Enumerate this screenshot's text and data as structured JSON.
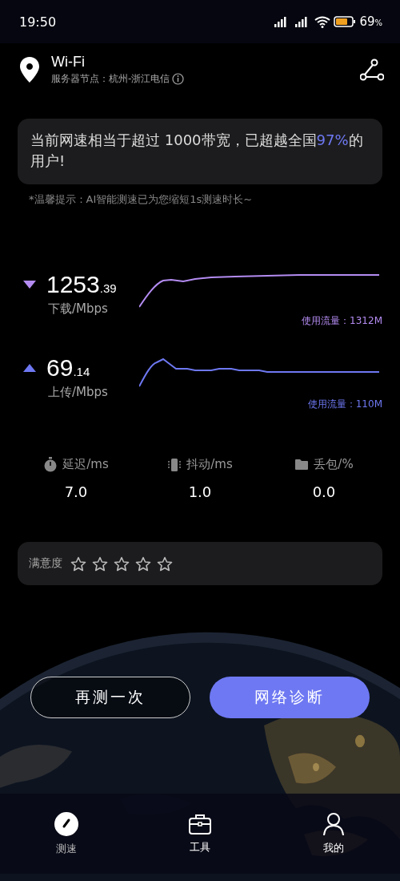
{
  "status_bar": {
    "time": "19:50",
    "battery_percent": "69",
    "battery_unit": "%"
  },
  "header": {
    "title": "Wi-Fi",
    "server": "服务器节点：杭州-浙江电信"
  },
  "summary": {
    "before": "当前网速相当于超过 1000带宽，已超越全国",
    "highlight": "97%",
    "after": "的用户!"
  },
  "tip": "*温馨提示：AI智能测速已为您缩短1s测速时长~",
  "speeds": [
    {
      "kind": "download",
      "value": "1253",
      "decimals": ".39",
      "unit": "下载/Mbps",
      "usage": "使用流量：1312M"
    },
    {
      "kind": "upload",
      "value": "69",
      "decimals": ".14",
      "unit": "上传/Mbps",
      "usage": "使用流量：110M"
    }
  ],
  "stats": [
    {
      "kind": "latency",
      "label": "延迟/ms",
      "value": "7.0"
    },
    {
      "kind": "jitter",
      "label": "抖动/ms",
      "value": "1.0"
    },
    {
      "kind": "loss",
      "label": "丢包/%",
      "value": "0.0"
    }
  ],
  "satisfaction": {
    "label": "满意度",
    "stars": 0
  },
  "buttons": [
    {
      "kind": "secondary",
      "label": "再测一次"
    },
    {
      "kind": "primary",
      "label": "网络诊断"
    }
  ],
  "nav": [
    {
      "kind": "speed",
      "label": "测速",
      "selected": true
    },
    {
      "kind": "tools",
      "label": "工具",
      "selected": false
    },
    {
      "kind": "profile",
      "label": "我的",
      "selected": false
    }
  ]
}
